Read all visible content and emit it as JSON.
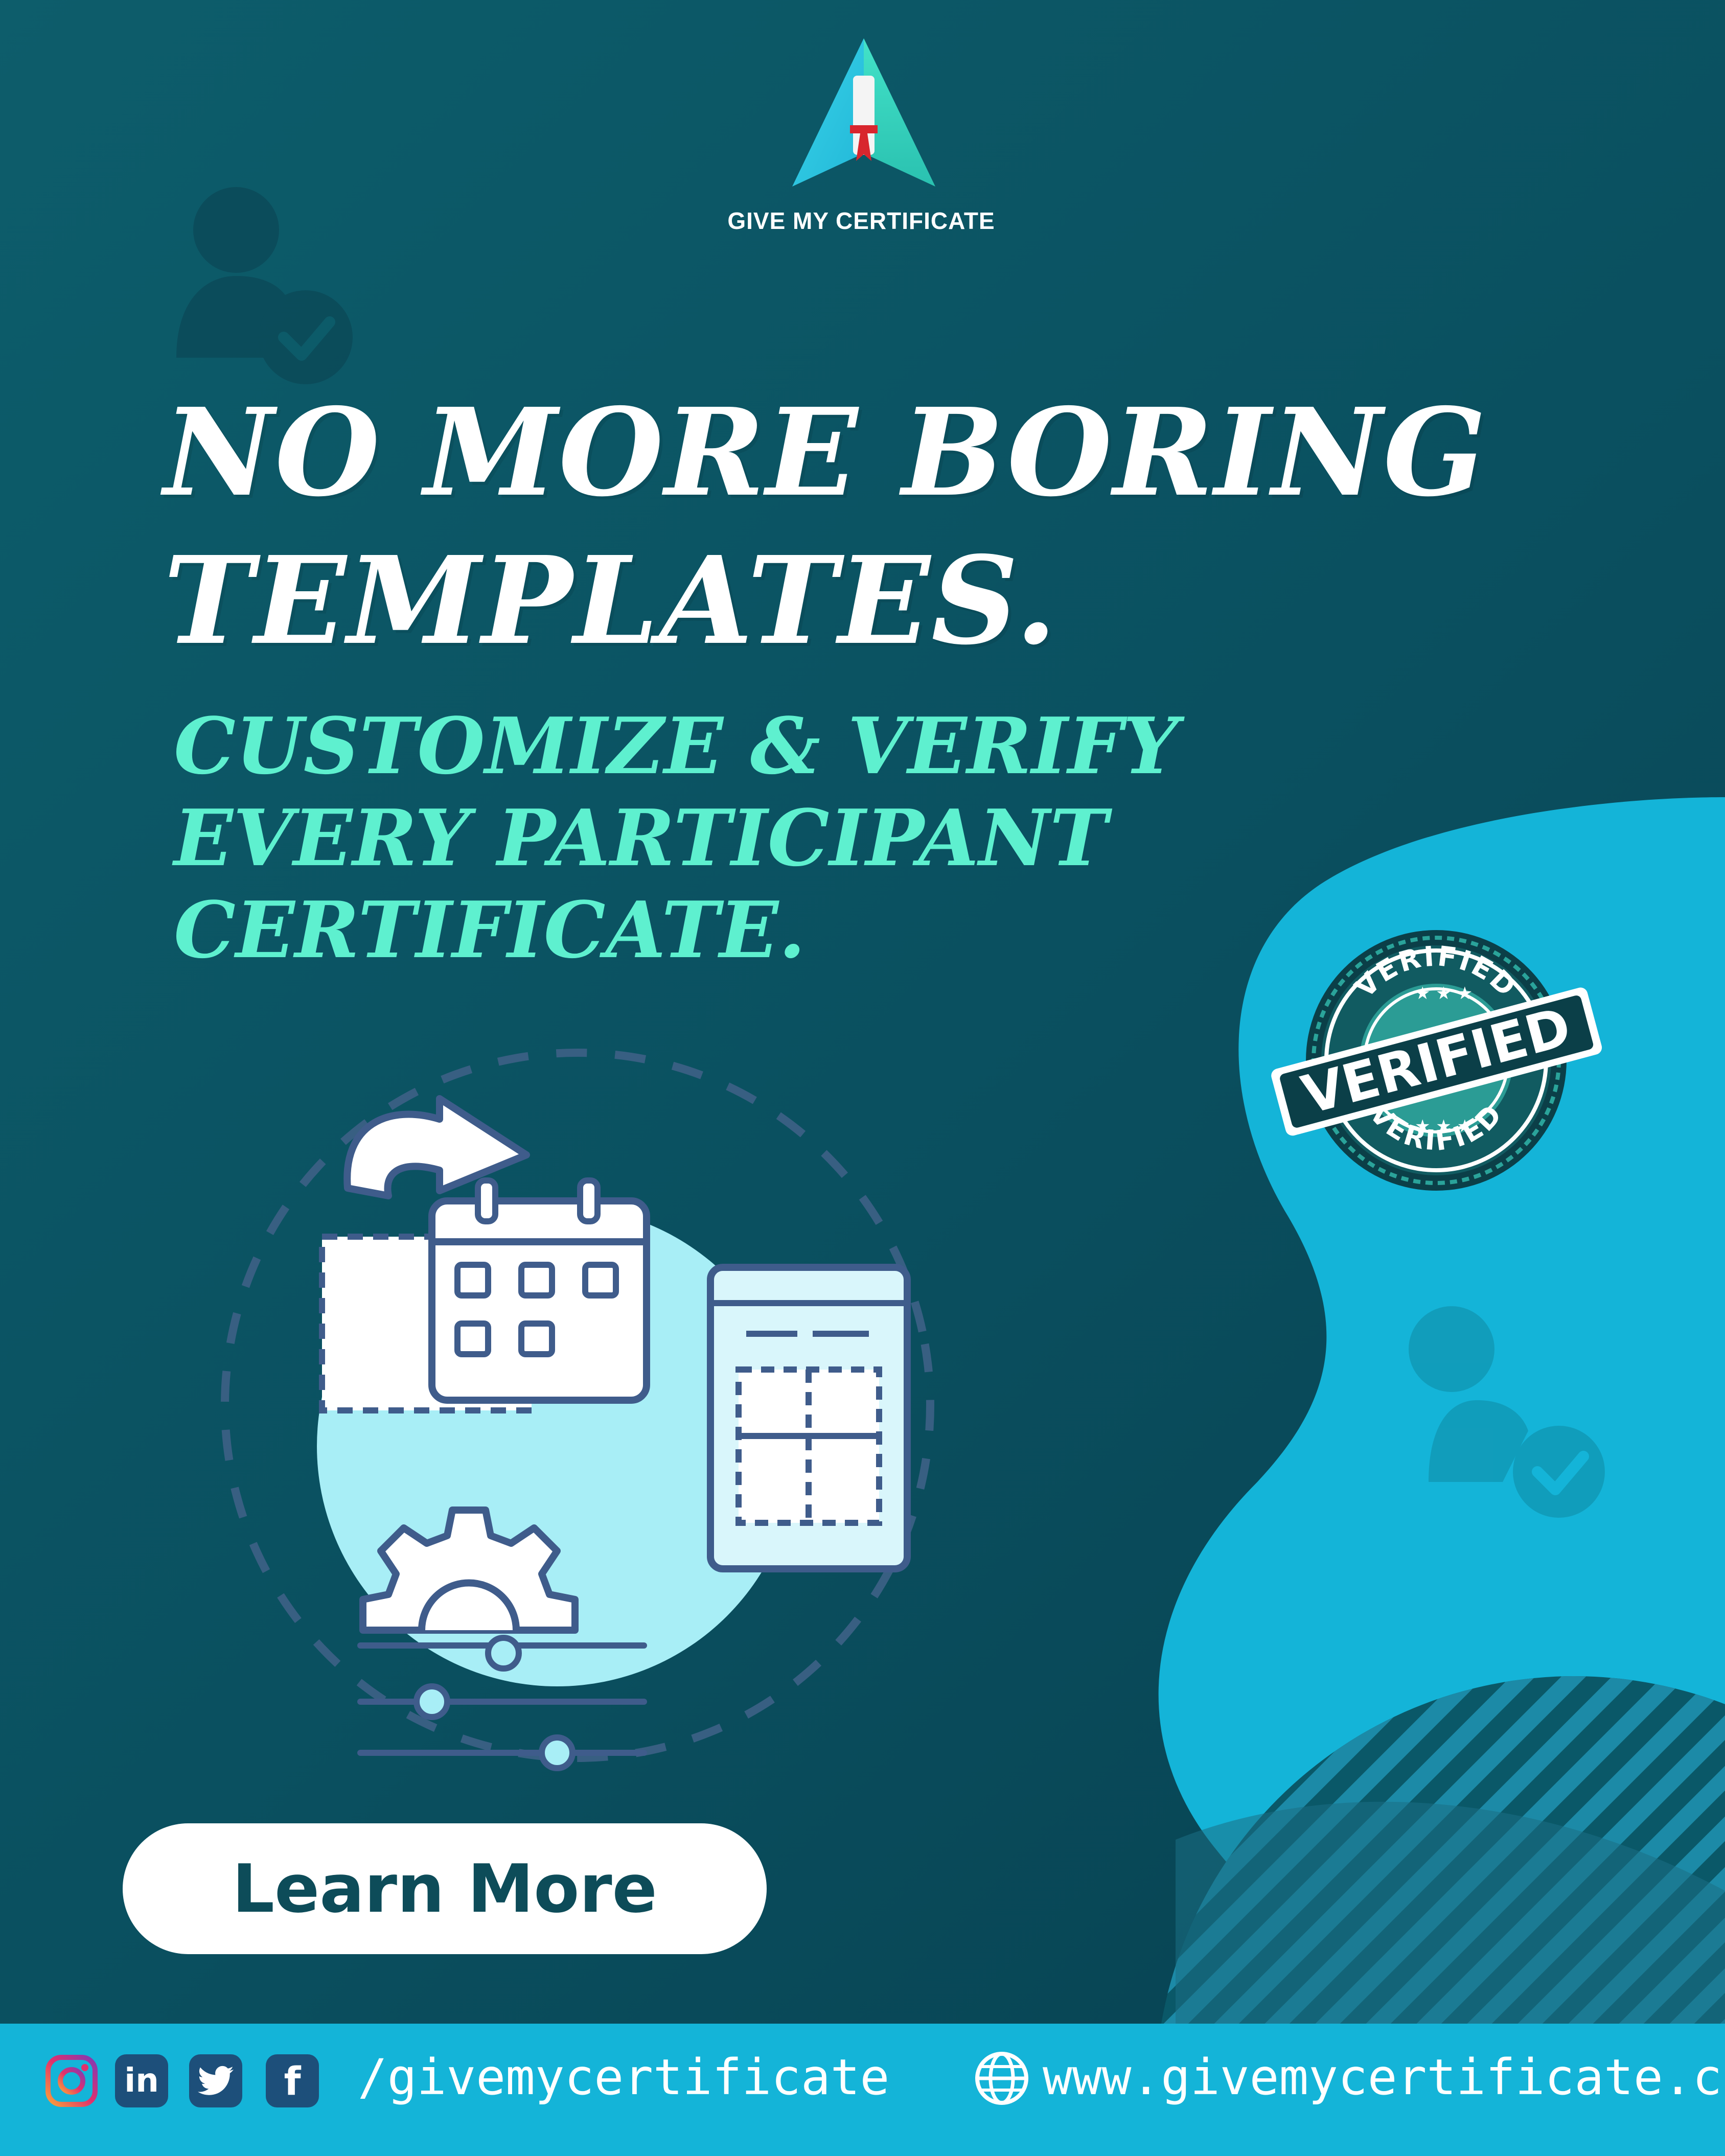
{
  "brand": {
    "name": "GIVE MY CERTIFICATE"
  },
  "headline": {
    "line1": "NO MORE BORING",
    "line2": "TEMPLATES."
  },
  "subheadline": {
    "line1": "CUSTOMIZE & VERIFY",
    "line2": "EVERY PARTICIPANT",
    "line3": "CERTIFICATE."
  },
  "badge": {
    "ring_top": "VERIFIED",
    "banner": "VERIFIED",
    "ring_bottom": "VERIFIED"
  },
  "cta": {
    "label": "Learn More"
  },
  "footer": {
    "social_handle": "/givemycertificate",
    "website": "www.givemycertificate.com",
    "social_icons": [
      "instagram-icon",
      "linkedin-icon",
      "twitter-icon",
      "facebook-icon"
    ]
  },
  "colors": {
    "background": "#0b5565",
    "headline": "#ffffff",
    "subheadline": "#5ef0cf",
    "accent_blob": "#14b4d8",
    "footer": "#14b4d8",
    "cta_text": "#0d4c59"
  }
}
